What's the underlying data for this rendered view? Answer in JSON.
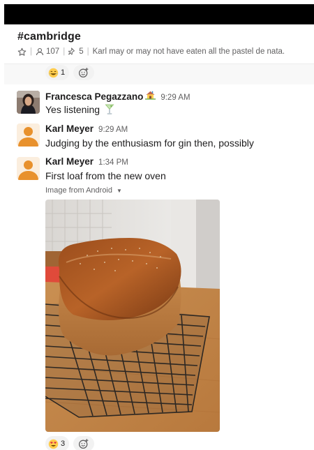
{
  "channel": {
    "name": "#cambridge",
    "member_count": "107",
    "pinned_count": "5",
    "topic": "Karl may or may not have eaten all the pastel de nata.",
    "icons": [
      "star-icon",
      "member-icon",
      "pin-icon"
    ]
  },
  "pinned_reactions": [
    {
      "emoji": "laughing-emoji",
      "count": "1"
    }
  ],
  "messages": [
    {
      "author": "Francesca Pegazzano",
      "status_emoji": "house-emoji",
      "time": "9:29 AM",
      "text": "Yes listening",
      "text_emoji": "cocktail-emoji",
      "avatar": "photo"
    },
    {
      "author": "Karl Meyer",
      "time": "9:29 AM",
      "text": "Judging by the enthusiasm for gin then, possibly",
      "avatar": "default"
    },
    {
      "author": "Karl Meyer",
      "time": "1:34 PM",
      "text": "First loaf from the new oven",
      "avatar": "default",
      "attachment": {
        "label": "Image from Android",
        "kind": "photo of a loaf of bread on a cooling rack"
      },
      "reactions": [
        {
          "emoji": "heart-eyes-emoji",
          "count": "3"
        }
      ]
    }
  ],
  "colors": {
    "avatar_orange": "#e8912d",
    "avatar_bg": "#fbeede",
    "reaction_bg": "#f2f2f2",
    "muted_text": "#616061"
  }
}
